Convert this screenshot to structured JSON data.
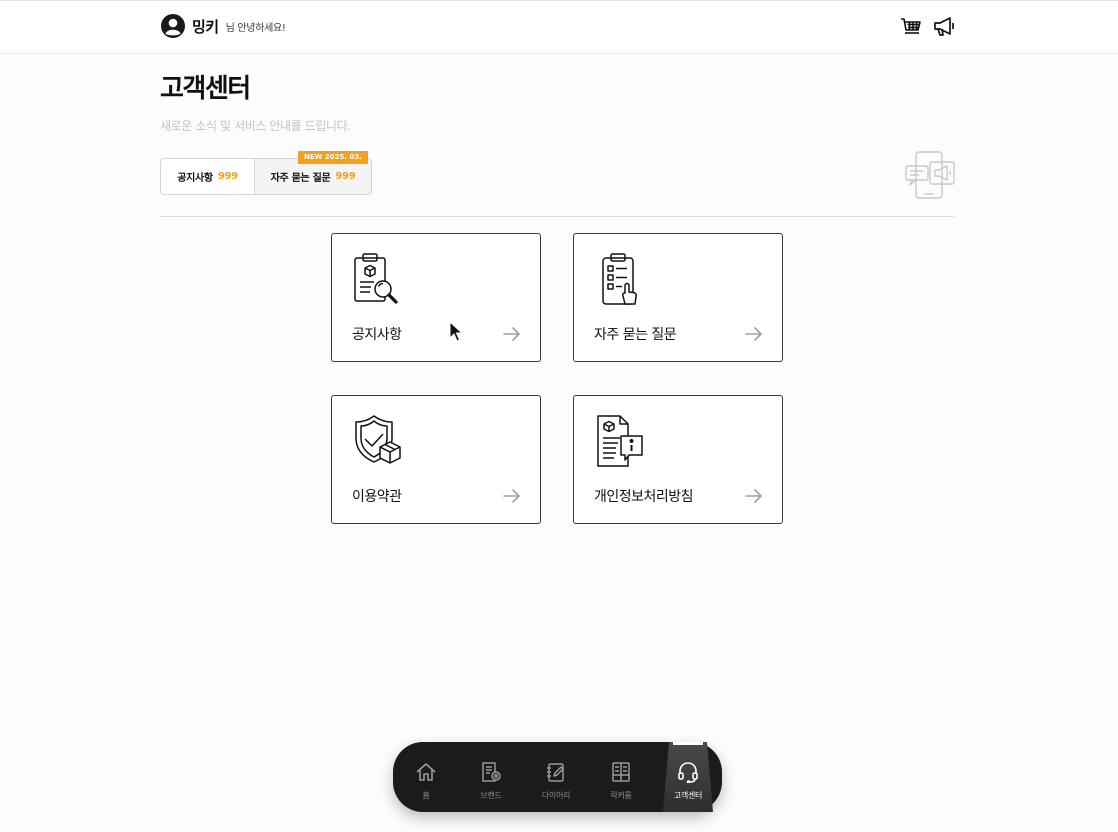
{
  "header": {
    "user_name": "밍키",
    "greeting": "님 안녕하세요!",
    "icons": [
      "cart-icon",
      "megaphone-icon"
    ]
  },
  "page": {
    "title": "고객센터",
    "subtitle": "새로운 소식 및 서비스 안내를 드립니다."
  },
  "tabs": [
    {
      "label": "공지사항",
      "count": "999"
    },
    {
      "label": "자주 묻는 질문",
      "count": "999",
      "badge": "NEW 2025. 03."
    }
  ],
  "cards": [
    {
      "label": "공지사항",
      "icon": "clipboard-search-icon"
    },
    {
      "label": "자주 묻는 질문",
      "icon": "checklist-touch-icon"
    },
    {
      "label": "이용약관",
      "icon": "shield-box-icon"
    },
    {
      "label": "개인정보처리방침",
      "icon": "document-info-icon"
    }
  ],
  "bottom_nav": [
    {
      "label": "홈",
      "icon": "home-icon"
    },
    {
      "label": "브랜드",
      "icon": "brand-book-icon"
    },
    {
      "label": "다이어리",
      "icon": "diary-icon"
    },
    {
      "label": "락커룸",
      "icon": "locker-icon"
    },
    {
      "label": "고객센터",
      "icon": "headset-icon",
      "active": true
    }
  ],
  "colors": {
    "accent": "#f2a01e",
    "nav_bg": "#1b1b1b",
    "border": "#3a3a3a"
  }
}
